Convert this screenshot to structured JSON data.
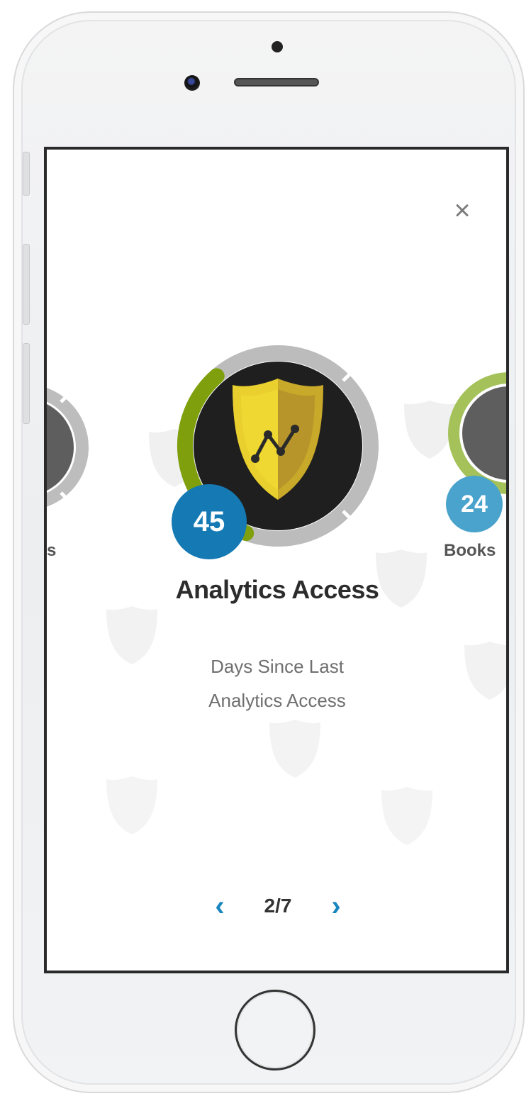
{
  "modal": {
    "close_label": "×",
    "current_badge": {
      "count": "45",
      "title": "Analytics Access",
      "description_line1": "Days Since Last",
      "description_line2": "Analytics Access",
      "progress_fraction": 0.33,
      "ring_color": "#7fa00c",
      "count_color": "#157ab4",
      "icon": "shield-trend-icon"
    },
    "previous_badge": {
      "label_fragment": "s",
      "icon": "shield-icon"
    },
    "next_badge": {
      "count": "24",
      "label": "Books",
      "count_color": "#4aa3cc",
      "ring_color": "#a4c15a",
      "icon": "shield-icon"
    },
    "pager": {
      "prev_label": "‹",
      "next_label": "›",
      "position": "2/7"
    }
  }
}
